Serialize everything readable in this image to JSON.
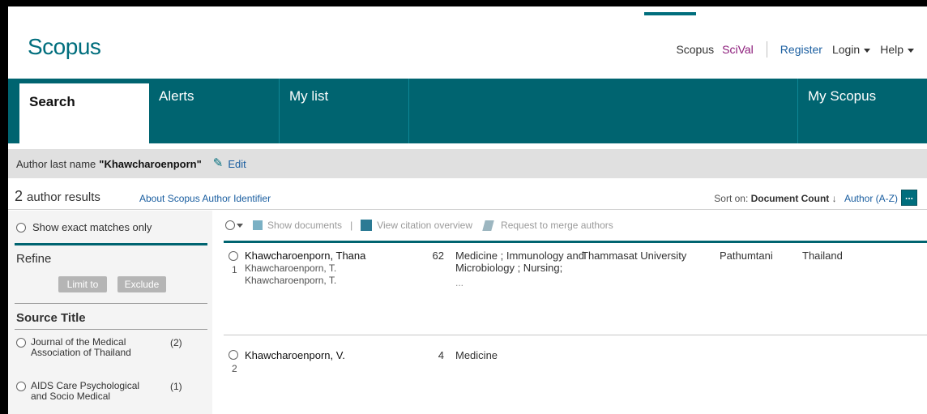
{
  "header": {
    "logo": "Scopus",
    "nav": {
      "scopus": "Scopus",
      "scival": "SciVal",
      "register": "Register",
      "login": "Login",
      "help": "Help"
    }
  },
  "tabs": [
    {
      "label": "Search"
    },
    {
      "label": "Alerts"
    },
    {
      "label": "My list"
    },
    {
      "label": "My Scopus"
    }
  ],
  "search": {
    "query_prefix": "Author last name",
    "query_value": "\"Khawcharoenporn\"",
    "edit": "Edit"
  },
  "results": {
    "count": "2",
    "count_label": "author results",
    "about_link": "About Scopus Author Identifier",
    "sort_prefix": "Sort on:",
    "sort_active": "Document Count",
    "sort_arrow": "↓",
    "sort_alt": "Author (A-Z)",
    "more": "..."
  },
  "refine": {
    "exact_label": "Show exact matches only",
    "title": "Refine",
    "limit": "Limit to",
    "exclude": "Exclude",
    "source_title": "Source Title",
    "sources": [
      {
        "name": "Journal of the Medical Association of Thailand",
        "count": "(2)"
      },
      {
        "name": "AIDS Care Psychological and Socio Medical",
        "count": "(1)"
      }
    ]
  },
  "toolbar": {
    "show_documents": "Show documents",
    "separator": "|",
    "view_citation": "View citation overview",
    "request_merge": "Request to merge authors"
  },
  "rows": [
    {
      "index": "1",
      "author": "Khawcharoenporn, Thana",
      "alt1": "Khawcharoenporn, T.",
      "alt2": "Khawcharoenporn, T.",
      "count": "62",
      "subject": "Medicine ; Immunology and Microbiology ; Nursing;",
      "subject_more": "...",
      "affiliation": "Thammasat University",
      "city": "Pathumtani",
      "country": "Thailand"
    },
    {
      "index": "2",
      "author": "Khawcharoenporn, V.",
      "count": "4",
      "subject": "Medicine"
    }
  ],
  "colors": {
    "brand": "#006e7d",
    "tab_bar": "#006470",
    "link": "#1a5ea0",
    "scival": "#8b1a7a"
  }
}
